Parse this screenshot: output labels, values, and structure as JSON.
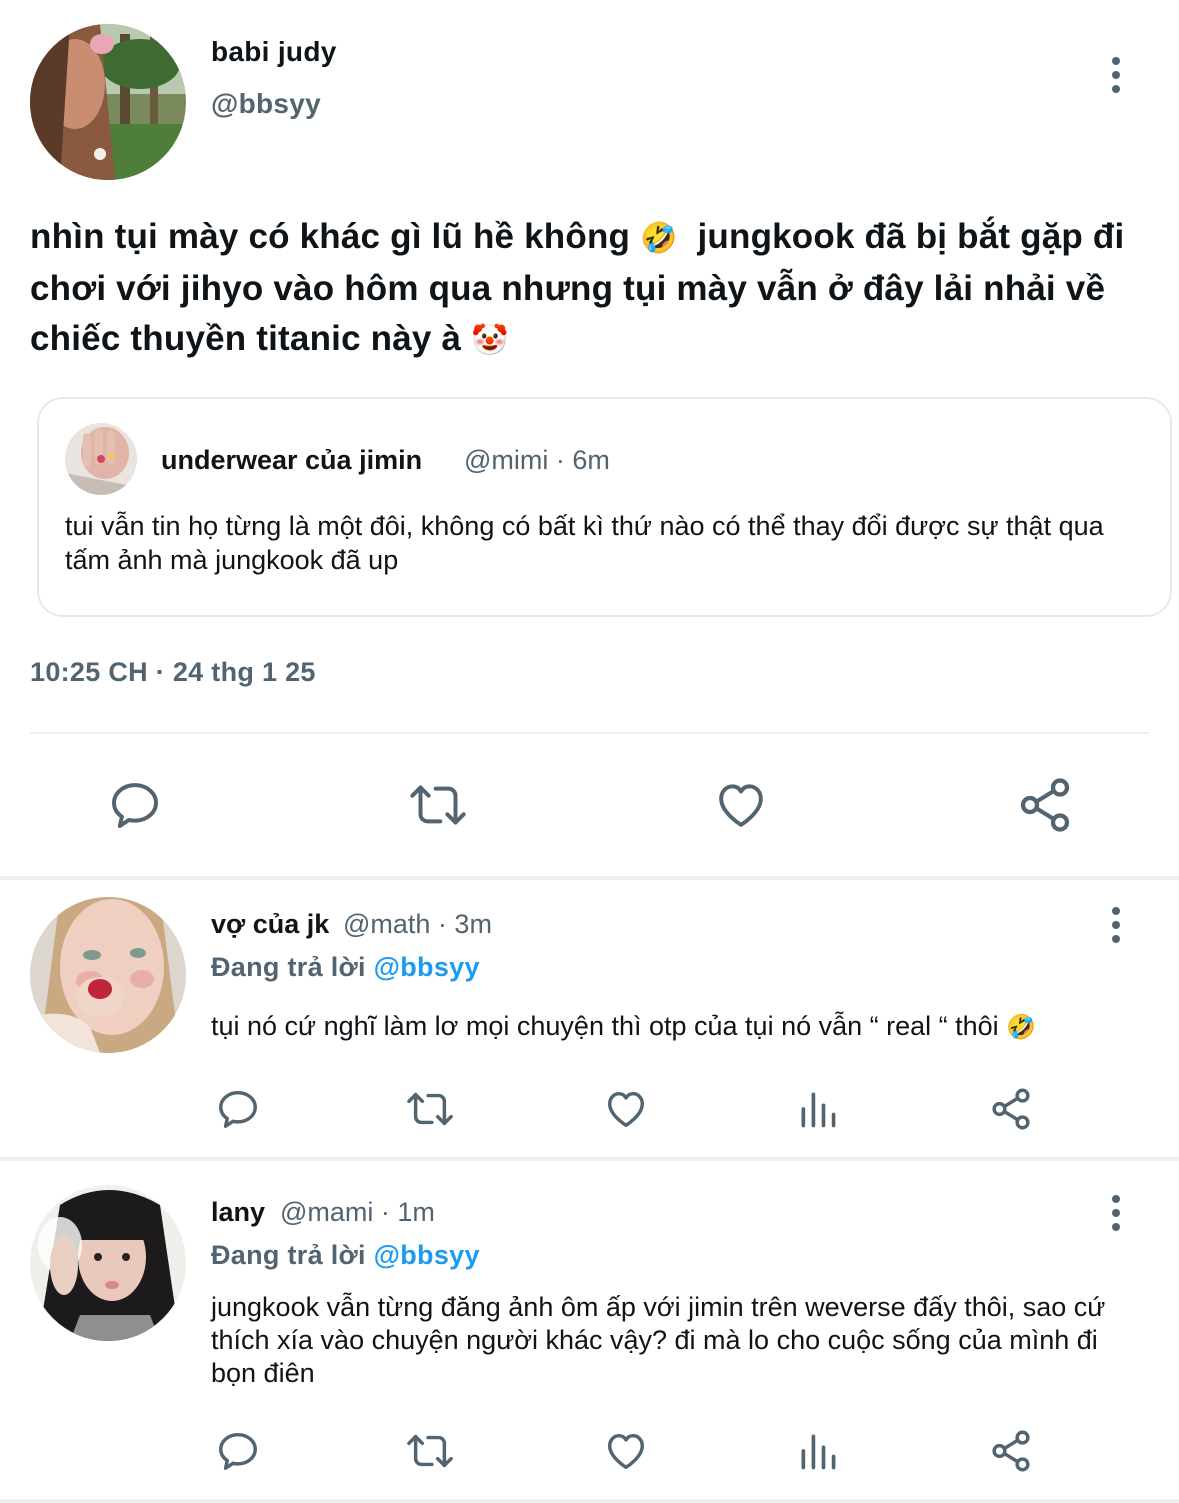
{
  "main_tweet": {
    "author_name": "babi judy",
    "author_handle": "@bbsyy",
    "text": "nhìn tụi mày có khác gì lũ hề không",
    "text_emoji_1": "🤣",
    "text_2": "jungkook đã bị bắt gặp đi chơi với jihyo vào hôm qua nhưng tụi mày vẫn ở đây lải nhải về chiếc thuyền titanic này à",
    "text_emoji_2": "🤡",
    "timestamp": "10:25 CH · 24 thg 1 25",
    "quoted": {
      "author_name": "underwear của jimin",
      "meta": "@mimi · 6m",
      "text": "tui vẫn tin họ từng là một đôi, không có bất kì thứ nào có thể thay đổi được sự thật qua tấm ảnh mà jungkook đã up"
    },
    "actions": [
      "reply-icon",
      "retweet-icon",
      "like-icon",
      "share-icon"
    ]
  },
  "replies": [
    {
      "author_name": "vợ của jk",
      "meta": "@math · 3m",
      "replying_label": "Đang trả lời",
      "replying_to": "@bbsyy",
      "text": "tụi nó cứ nghĩ làm lơ mọi chuyện thì otp của tụi nó vẫn “ real “ thôi",
      "text_emoji": "🤣"
    },
    {
      "author_name": "lany",
      "meta": "@mami · 1m",
      "replying_label": "Đang trả lời",
      "replying_to": "@bbsyy",
      "text": "jungkook vẫn từng đăng ảnh ôm ấp với jimin trên weverse đấy thôi, sao cứ thích xía vào chuyện người khác vậy? đi mà lo cho cuộc sống của mình đi bọn điên"
    }
  ],
  "colors": {
    "text_primary": "#0f1419",
    "text_secondary": "#536471",
    "link": "#1d9bf0",
    "divider": "#eceef0",
    "icon": "#536471"
  }
}
